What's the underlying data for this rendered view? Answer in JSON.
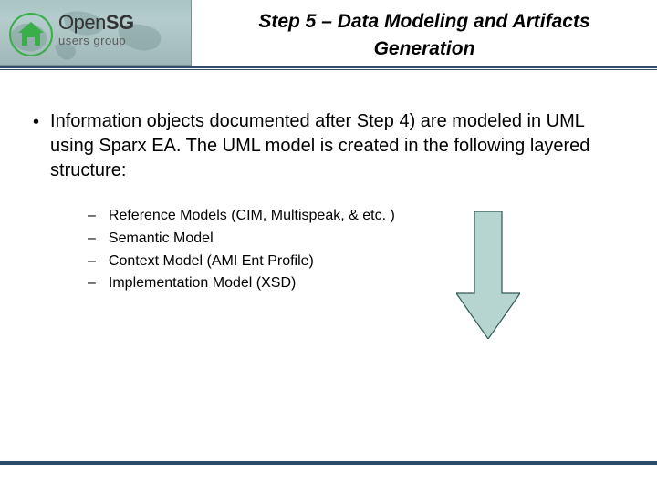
{
  "logo": {
    "open": "Open",
    "sg": "SG",
    "subtitle": "users group"
  },
  "title": {
    "line1": "Step 5 – Data Modeling and Artifacts",
    "line2": "Generation"
  },
  "main_bullet": "Information objects documented after Step 4) are modeled in UML using Sparx EA. The UML model is created in the following layered structure:",
  "sub_items": [
    "Reference Models (CIM, Multispeak, & etc. )",
    "Semantic Model",
    "Context Model (AMI Ent Profile)",
    "Implementation Model (XSD)"
  ],
  "colors": {
    "arrow_fill": "#b6d4d0",
    "arrow_stroke": "#2f5b57"
  }
}
